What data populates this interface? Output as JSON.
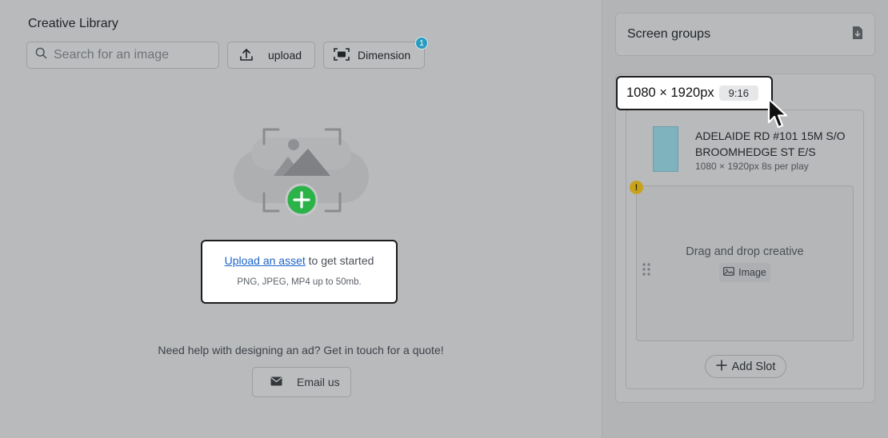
{
  "library": {
    "title": "Creative Library",
    "search_placeholder": "Search for an image",
    "upload_label": "upload",
    "dimension_label": "Dimension",
    "dimension_badge": "1"
  },
  "empty_state": {
    "upload_link": "Upload an asset",
    "upload_suffix": " to get started",
    "formats": "PNG, JPEG, MP4 up to 50mb."
  },
  "help": {
    "text": "Need help with designing an ad? Get in touch for a quote!",
    "email_label": "Email us"
  },
  "screen_groups": {
    "title": "Screen groups",
    "dimension": "1080 × 1920px",
    "ratio": "9:16",
    "screen": {
      "name": "ADELAIDE RD #101 15M S/O BROOMHEDGE ST E/S",
      "meta": "1080 × 1920px 8s per play"
    },
    "warning": "!",
    "drop_text": "Drag and drop creative",
    "image_tag": "Image",
    "add_slot": "Add Slot"
  },
  "colors": {
    "accent_green": "#2bb34a",
    "badge_blue": "#2a9cbf",
    "warning_yellow": "#c9a21d",
    "link_blue": "#1d63c9"
  },
  "icons": [
    "search-icon",
    "upload-icon",
    "dimension-icon",
    "image-add-icon",
    "mail-icon",
    "file-download-icon",
    "warning-icon",
    "drag-handle-icon",
    "image-icon",
    "plus-icon",
    "cursor-icon"
  ]
}
